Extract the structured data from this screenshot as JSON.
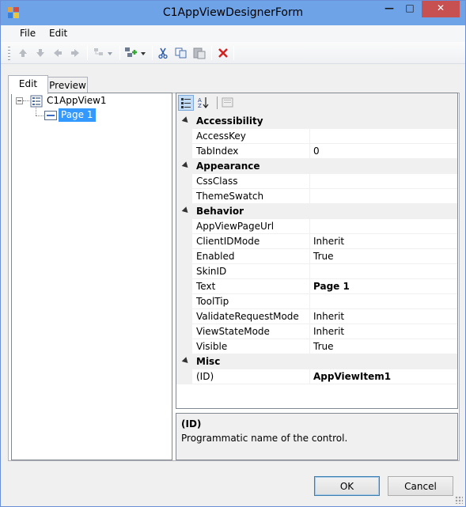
{
  "window": {
    "title": "C1AppViewDesignerForm"
  },
  "menu": {
    "items": [
      "File",
      "Edit"
    ]
  },
  "toolbar": {
    "buttons": [
      "up-icon",
      "down-icon",
      "left-icon",
      "right-icon",
      "tree-add-icon",
      "add-item-icon",
      "cut-icon",
      "copy-icon",
      "paste-icon",
      "delete-icon"
    ]
  },
  "tabs": [
    {
      "label": "Edit",
      "selected": true
    },
    {
      "label": "Preview",
      "selected": false
    }
  ],
  "tree": {
    "root": "C1AppView1",
    "child": "Page 1"
  },
  "propgrid": {
    "rows": [
      {
        "type": "category",
        "name": "Accessibility"
      },
      {
        "type": "prop",
        "name": "AccessKey",
        "value": ""
      },
      {
        "type": "prop",
        "name": "TabIndex",
        "value": "0"
      },
      {
        "type": "category",
        "name": "Appearance"
      },
      {
        "type": "prop",
        "name": "CssClass",
        "value": ""
      },
      {
        "type": "prop",
        "name": "ThemeSwatch",
        "value": ""
      },
      {
        "type": "category",
        "name": "Behavior"
      },
      {
        "type": "prop",
        "name": "AppViewPageUrl",
        "value": ""
      },
      {
        "type": "prop",
        "name": "ClientIDMode",
        "value": "Inherit"
      },
      {
        "type": "prop",
        "name": "Enabled",
        "value": "True"
      },
      {
        "type": "prop",
        "name": "SkinID",
        "value": ""
      },
      {
        "type": "prop",
        "name": "Text",
        "value": "Page 1",
        "bold": true
      },
      {
        "type": "prop",
        "name": "ToolTip",
        "value": ""
      },
      {
        "type": "prop",
        "name": "ValidateRequestMode",
        "value": "Inherit"
      },
      {
        "type": "prop",
        "name": "ViewStateMode",
        "value": "Inherit"
      },
      {
        "type": "prop",
        "name": "Visible",
        "value": "True"
      },
      {
        "type": "category",
        "name": "Misc"
      },
      {
        "type": "prop",
        "name": "(ID)",
        "value": "AppViewItem1",
        "bold": true
      }
    ],
    "description": {
      "title": "(ID)",
      "text": "Programmatic name of the control."
    }
  },
  "buttons": {
    "ok": "OK",
    "cancel": "Cancel"
  },
  "colors": {
    "titlebar": "#6fa3e8",
    "selection": "#3399ff",
    "close": "#c75050"
  }
}
